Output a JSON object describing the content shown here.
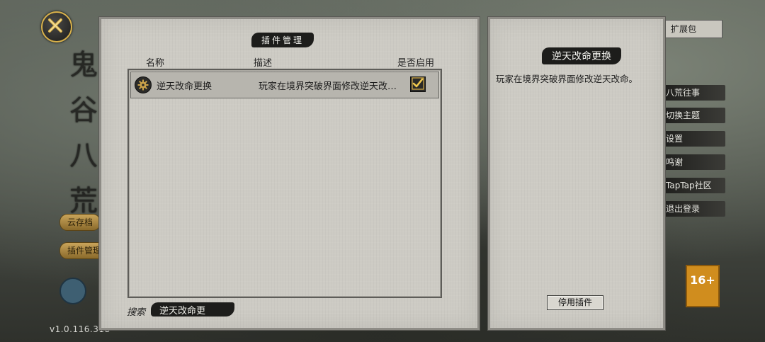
{
  "plugin_manager": {
    "title": "插件管理",
    "columns": {
      "name": "名称",
      "description": "描述",
      "enabled": "是否启用"
    },
    "plugins": [
      {
        "name": "逆天改命更换",
        "description": "玩家在境界突破界面修改逆天改…",
        "enabled": true,
        "icon": "gear-icon"
      }
    ],
    "search": {
      "label": "搜索",
      "value": "逆天改命更"
    }
  },
  "detail": {
    "title": "逆天改命更换",
    "description": "玩家在境界突破界面修改逆天改命。",
    "disable_button": "停用插件"
  },
  "close_icon": "close-icon",
  "colors": {
    "accent_gold": "#d9b14a",
    "ink": "#1d1d1b",
    "paper": "#cdcbc4"
  }
}
